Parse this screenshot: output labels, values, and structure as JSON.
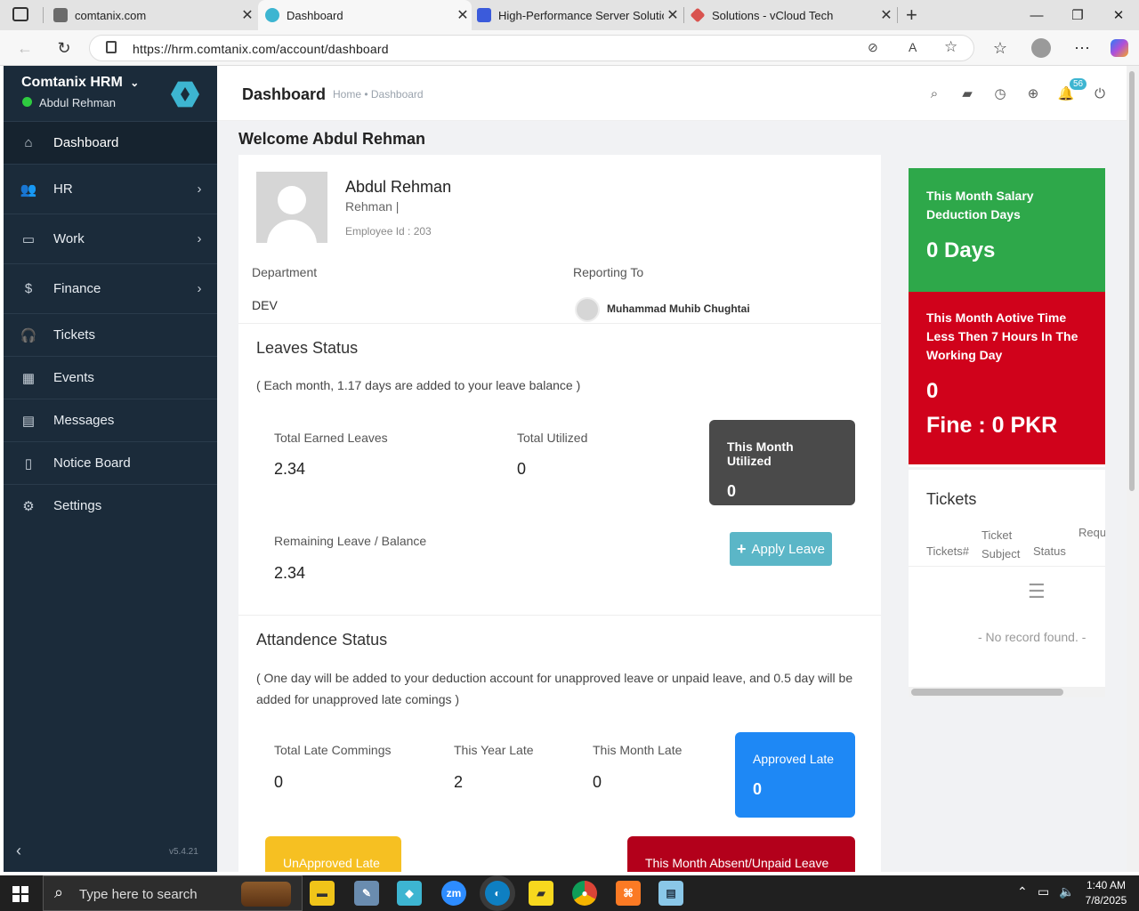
{
  "browser": {
    "tabs": [
      {
        "label": "comtanix.com",
        "color": "#6b6b6b"
      },
      {
        "label": "Dashboard",
        "color": "#3db5d1"
      },
      {
        "label": "High-Performance Server Solution",
        "color": "#3b5bdb"
      },
      {
        "label": "Solutions - vCloud Tech",
        "color": "#d9534f"
      }
    ],
    "url": "https://hrm.comtanix.com/account/dashboard"
  },
  "sidebar": {
    "brand": "Comtanix HRM",
    "user": "Abdul Rehman",
    "version": "v5.4.21",
    "items": [
      {
        "label": "Dashboard",
        "icon": "home-icon",
        "glyph": "⌂",
        "chevron": false,
        "active": true
      },
      {
        "label": "HR",
        "icon": "users-icon",
        "glyph": "👥",
        "chevron": true
      },
      {
        "label": "Work",
        "icon": "briefcase-icon",
        "glyph": "▭",
        "chevron": true
      },
      {
        "label": "Finance",
        "icon": "dollar-icon",
        "glyph": "$",
        "chevron": true
      },
      {
        "label": "Tickets",
        "icon": "headset-icon",
        "glyph": "🎧",
        "chevron": false
      },
      {
        "label": "Events",
        "icon": "calendar-icon",
        "glyph": "▦",
        "chevron": false
      },
      {
        "label": "Messages",
        "icon": "chat-icon",
        "glyph": "▤",
        "chevron": false
      },
      {
        "label": "Notice Board",
        "icon": "clipboard-icon",
        "glyph": "▯",
        "chevron": false
      },
      {
        "label": "Settings",
        "icon": "gear-icon",
        "glyph": "⚙",
        "chevron": false
      }
    ]
  },
  "header": {
    "title": "Dashboard",
    "breadcrumb": "Home • Dashboard",
    "notification_count": "56"
  },
  "main": {
    "welcome": "Welcome Abdul Rehman",
    "profile": {
      "name": "Abdul Rehman",
      "subtitle": "Rehman |",
      "employee_id": "Employee Id : 203",
      "department_label": "Department",
      "department": "DEV",
      "reporting_label": "Reporting To",
      "reporting_to": "Muhammad Muhib Chughtai"
    },
    "leaves": {
      "title": "Leaves Status",
      "note": "( Each month, 1.17 days are added to your leave balance )",
      "earned_label": "Total Earned Leaves",
      "earned": "2.34",
      "utilized_label": "Total Utilized",
      "utilized": "0",
      "month_utilized_label": "This Month Utilized",
      "month_utilized": "0",
      "remaining_label": "Remaining Leave / Balance",
      "remaining": "2.34",
      "apply_button": "Apply Leave"
    },
    "attendance": {
      "title": "Attandence Status",
      "note": "( One day will be added to your deduction account for unapproved leave or unpaid leave, and 0.5 day will be added for unapproved late comings )",
      "late_label": "Total Late Commings",
      "late": "0",
      "year_late_label": "This Year Late",
      "year_late": "2",
      "month_late_label": "This Month Late",
      "month_late": "0",
      "approved_label": "Approved Late",
      "approved": "0",
      "unapproved_label": "UnApproved Late",
      "absent_label": "This Month Absent/Unpaid Leave"
    }
  },
  "right": {
    "salary_title": "This Month Salary Deduction Days",
    "salary_value": "0 Days",
    "active_title": "This Month Aotive Time Less Then 7 Hours In The Working Day",
    "active_value": "0",
    "fine": "Fine : 0 PKR",
    "tickets_title": "Tickets",
    "columns": [
      "Tickets#",
      "Ticket Subject",
      "Status",
      "Requ"
    ],
    "empty": "- No record found. -"
  },
  "taskbar": {
    "search_placeholder": "Type here to search",
    "time": "1:40 AM",
    "date": "7/8/2025"
  },
  "colors": {
    "sidebar": "#1b2b3a",
    "accent": "#3db5d1",
    "green": "#2ea84a",
    "red": "#d0021b",
    "blue": "#1e88f5",
    "yellow": "#f6c022",
    "darkred": "#b3001b"
  }
}
